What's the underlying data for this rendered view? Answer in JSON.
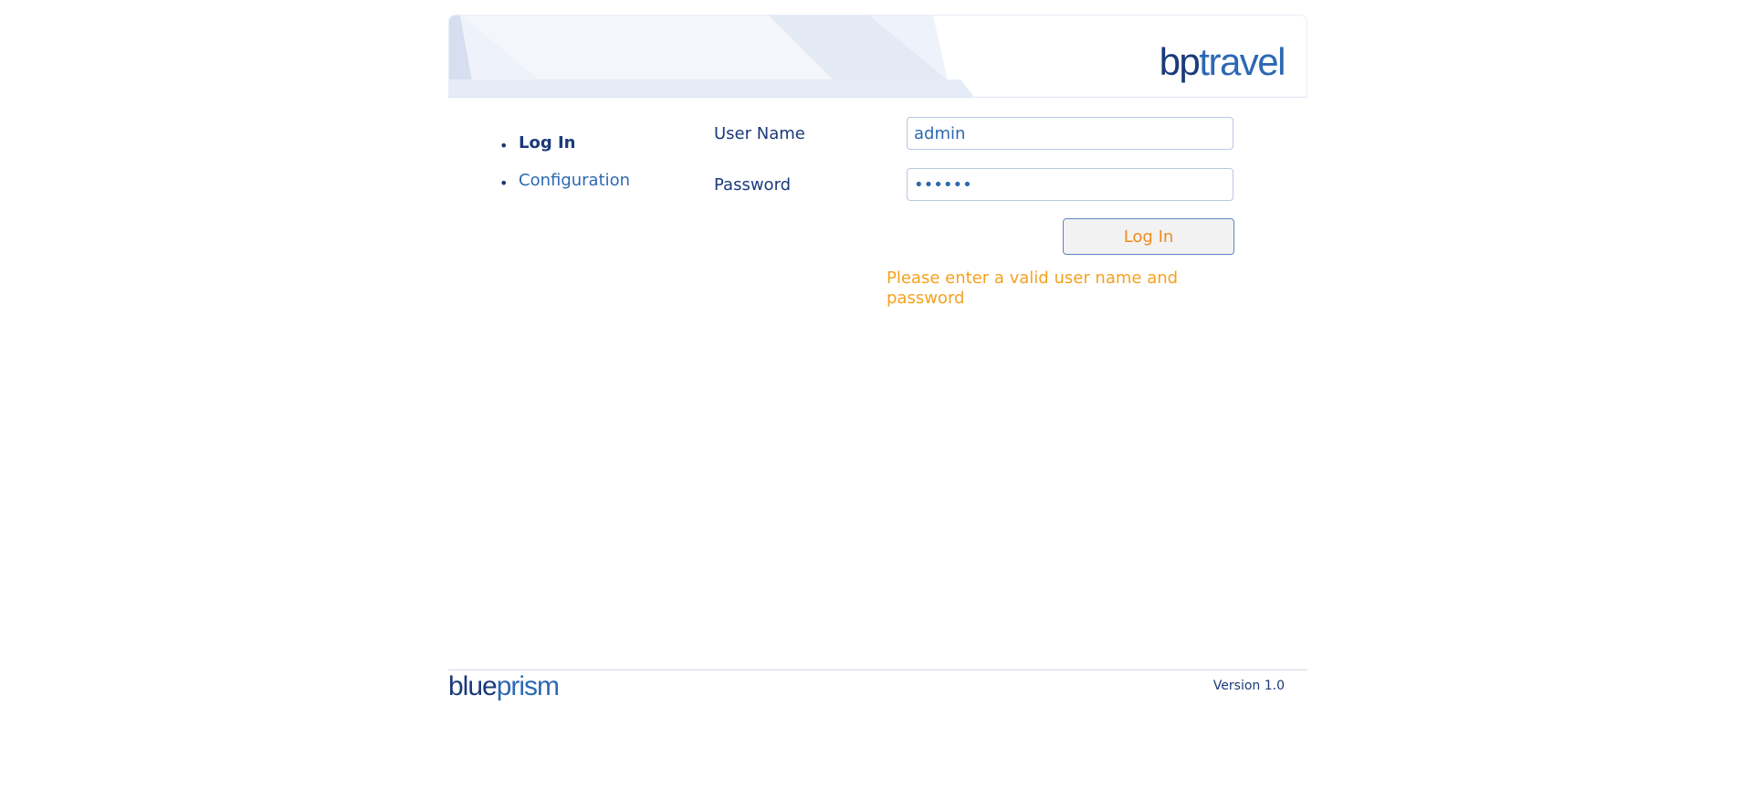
{
  "header": {
    "brand_part1": "bp",
    "brand_part2": "travel"
  },
  "nav": {
    "items": [
      {
        "label": "Log In",
        "active": true
      },
      {
        "label": "Configuration",
        "active": false
      }
    ]
  },
  "form": {
    "username_label": "User Name",
    "username_value": "admin",
    "password_label": "Password",
    "password_value": "••••••",
    "login_button": "Log In",
    "error_message": "Please enter a valid user name and password"
  },
  "footer": {
    "logo_part1": "blue",
    "logo_part2": "prism",
    "version": "Version 1.0"
  },
  "colors": {
    "navy": "#1b3a7a",
    "blue": "#2c69b3",
    "orange": "#f08a1c",
    "error": "#f5a11e"
  }
}
